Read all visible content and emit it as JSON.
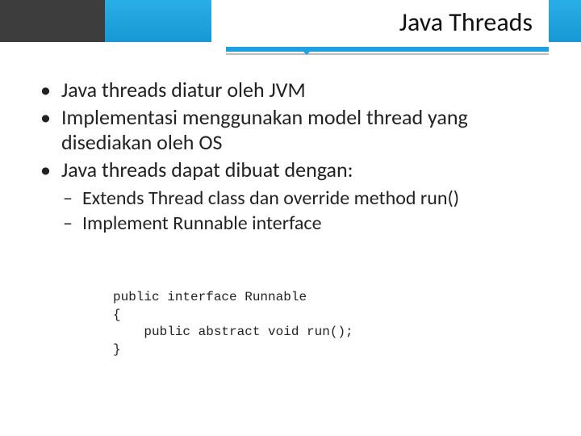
{
  "title": "Java Threads",
  "bullets": {
    "b0": "Java threads diatur oleh JVM",
    "b1": "Implementasi menggunakan model thread yang disediakan oleh OS",
    "b2": "Java threads dapat dibuat dengan:"
  },
  "subbullets": {
    "s0": "Extends Thread class dan override method run()",
    "s1": "Implement Runnable interface"
  },
  "code": {
    "l0": "public interface Runnable",
    "l1": "{",
    "l2": "    public abstract void run();",
    "l3": "}"
  }
}
